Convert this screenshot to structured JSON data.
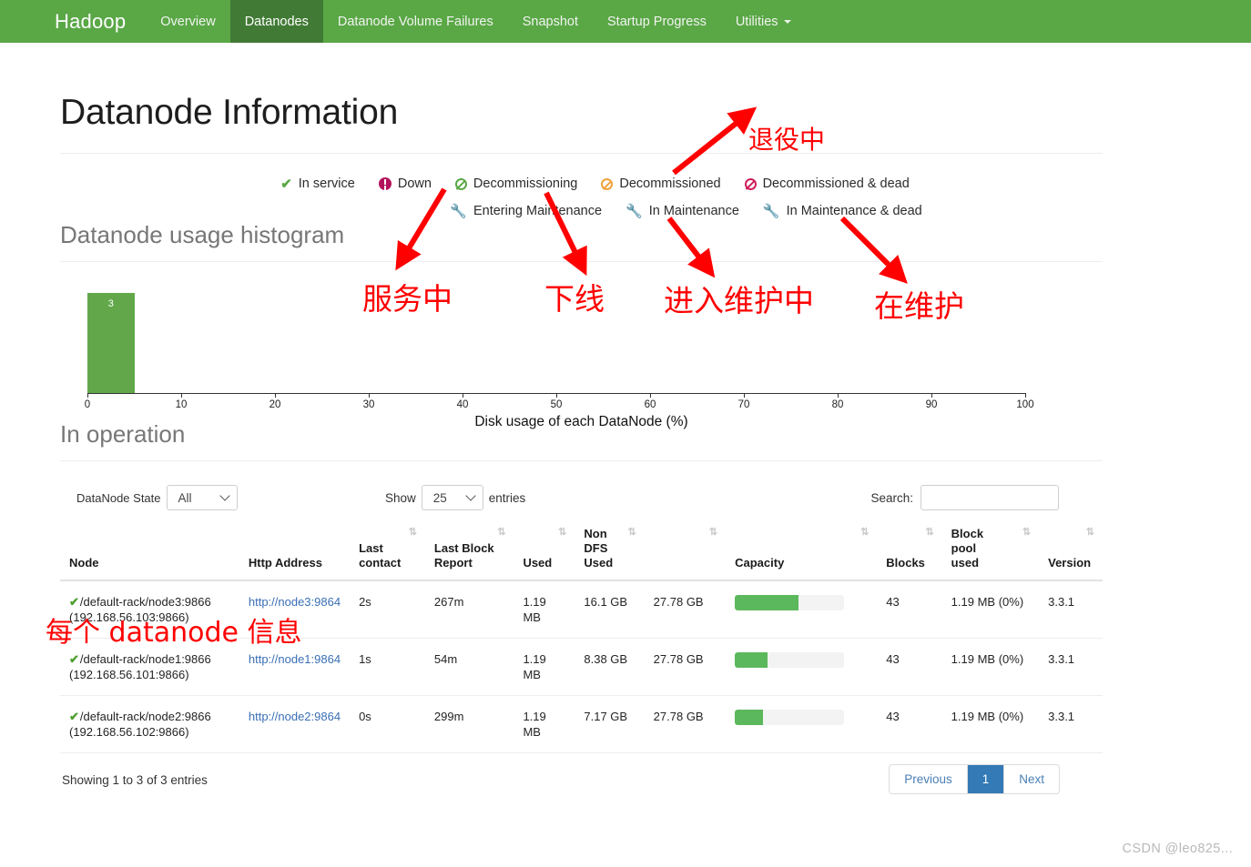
{
  "navbar": {
    "brand": "Hadoop",
    "items": [
      {
        "label": "Overview",
        "active": false
      },
      {
        "label": "Datanodes",
        "active": true
      },
      {
        "label": "Datanode Volume Failures",
        "active": false
      },
      {
        "label": "Snapshot",
        "active": false
      },
      {
        "label": "Startup Progress",
        "active": false
      },
      {
        "label": "Utilities",
        "active": false,
        "has_caret": true
      }
    ],
    "bg_color": "#5aa746",
    "active_color": "#417a35"
  },
  "page": {
    "title": "Datanode Information",
    "histogram_heading": "Datanode usage histogram",
    "in_operation_heading": "In operation"
  },
  "legend": {
    "row1": [
      {
        "label": "In service",
        "icon": "check-icon",
        "color": "#5aa746"
      },
      {
        "label": "Down",
        "icon": "exclamation-circle-icon",
        "color": "#b3135c"
      },
      {
        "label": "Decommissioning",
        "icon": "circle-slash-icon",
        "color": "#5aa746"
      },
      {
        "label": "Decommissioned",
        "icon": "circle-slash-icon",
        "color": "#f0a23c"
      },
      {
        "label": "Decommissioned & dead",
        "icon": "circle-slash-icon",
        "color": "#cf1e5b"
      }
    ],
    "row2": [
      {
        "label": "Entering Maintenance",
        "icon": "wrench-icon",
        "color": "#5aa746"
      },
      {
        "label": "In Maintenance",
        "icon": "wrench-icon",
        "color": "#f0a23c"
      },
      {
        "label": "In Maintenance & dead",
        "icon": "wrench-icon",
        "color": "#cf1e5b"
      }
    ]
  },
  "chart_data": {
    "type": "bar",
    "title": "Datanode usage histogram",
    "xlabel": "Disk usage of each DataNode (%)",
    "ylabel": "",
    "xlim": [
      0,
      100
    ],
    "tick_labels": [
      "0",
      "10",
      "20",
      "30",
      "40",
      "50",
      "60",
      "70",
      "80",
      "90",
      "100"
    ],
    "ticks": [
      0,
      10,
      20,
      30,
      40,
      50,
      60,
      70,
      80,
      90,
      100
    ],
    "grid": false,
    "legend": "none",
    "bar_color": "#62a84a",
    "bins": [
      {
        "x_start": 0,
        "x_end": 5,
        "value": 3,
        "label": "3"
      }
    ],
    "categories": [
      "0-5"
    ],
    "values": [
      3
    ]
  },
  "controls": {
    "state_label": "DataNode State",
    "state_value": "All",
    "state_options": [
      "All"
    ],
    "show_label": "Show",
    "show_value": "25",
    "show_options": [
      "25"
    ],
    "entries_label": "entries",
    "search_label": "Search:",
    "search_value": "",
    "search_placeholder": ""
  },
  "table": {
    "columns": [
      {
        "label": "Node",
        "sortable": true
      },
      {
        "label": "Http Address",
        "sortable": true
      },
      {
        "label": "Last contact",
        "sortable": true
      },
      {
        "label": "Last Block Report",
        "sortable": true
      },
      {
        "label": "Used",
        "sortable": true
      },
      {
        "label": "Non DFS Used",
        "sortable": true
      },
      {
        "label": "",
        "sortable": true
      },
      {
        "label": "Capacity",
        "sortable": true
      },
      {
        "label": "Blocks",
        "sortable": true
      },
      {
        "label": "Block pool used",
        "sortable": true
      },
      {
        "label": "Version",
        "sortable": true
      }
    ],
    "sort_icon": "⇅",
    "rows": [
      {
        "status_icon": "check-icon",
        "node": "/default-rack/node3:9866",
        "node_ip": "(192.168.56.103:9866)",
        "http_address": "http://node3:9864",
        "last_contact": "2s",
        "last_block_report": "267m",
        "used": "1.19 MB",
        "non_dfs_used": "16.1 GB",
        "capacity_text": "27.78 GB",
        "capacity_percent": 58,
        "blocks": "43",
        "block_pool_used": "1.19 MB (0%)",
        "version": "3.3.1"
      },
      {
        "status_icon": "check-icon",
        "node": "/default-rack/node1:9866",
        "node_ip": "(192.168.56.101:9866)",
        "http_address": "http://node1:9864",
        "last_contact": "1s",
        "last_block_report": "54m",
        "used": "1.19 MB",
        "non_dfs_used": "8.38 GB",
        "capacity_text": "27.78 GB",
        "capacity_percent": 30,
        "blocks": "43",
        "block_pool_used": "1.19 MB (0%)",
        "version": "3.3.1"
      },
      {
        "status_icon": "check-icon",
        "node": "/default-rack/node2:9866",
        "node_ip": "(192.168.56.102:9866)",
        "http_address": "http://node2:9864",
        "last_contact": "0s",
        "last_block_report": "299m",
        "used": "1.19 MB",
        "non_dfs_used": "7.17 GB",
        "capacity_text": "27.78 GB",
        "capacity_percent": 26,
        "blocks": "43",
        "block_pool_used": "1.19 MB (0%)",
        "version": "3.3.1"
      }
    ]
  },
  "footer": {
    "showing": "Showing 1 to 3 of 3 entries",
    "previous": "Previous",
    "page_1": "1",
    "next": "Next",
    "watermark": "CSDN @leo825..."
  },
  "annotations": {
    "color": "#ff0000",
    "decommissioning": "退役中",
    "in_service": "服务中",
    "down": "下线",
    "entering_maintenance": "进入维护中",
    "in_maintenance": "在维护",
    "per_datanode_info": "每个 datanode 信息"
  }
}
